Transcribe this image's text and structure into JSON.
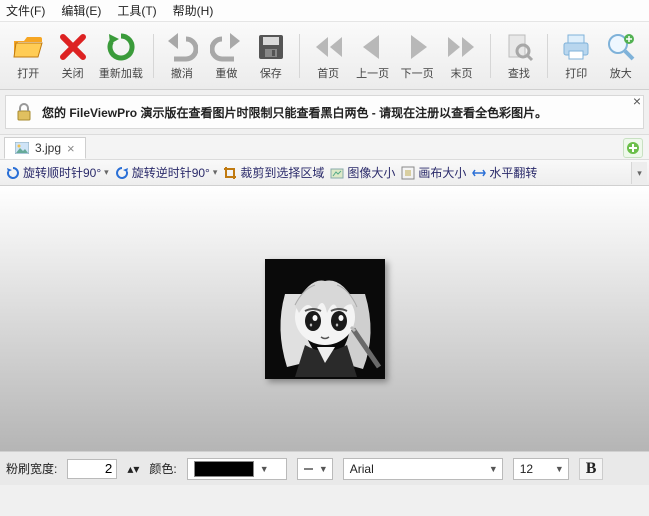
{
  "menu": {
    "file": "文件(F)",
    "edit": "编辑(E)",
    "tools": "工具(T)",
    "help": "帮助(H)"
  },
  "toolbar": {
    "open": "打开",
    "close": "关闭",
    "reload": "重新加载",
    "undo": "撤消",
    "redo": "重做",
    "save": "保存",
    "first": "首页",
    "prev": "上一页",
    "next": "下一页",
    "last": "末页",
    "find": "查找",
    "print": "打印",
    "zoom": "放大"
  },
  "banner": {
    "text": "您的 FileViewPro 演示版在查看图片时限制只能查看黑白两色 - 请现在注册以查看全色彩图片。"
  },
  "tab": {
    "label": "3.jpg"
  },
  "ops": {
    "rotate_cw": "旋转顺时针90°",
    "rotate_ccw": "旋转逆时针90°",
    "crop": "裁剪到选择区域",
    "image_size": "图像大小",
    "canvas_size": "画布大小",
    "flip_h": "水平翻转"
  },
  "footer": {
    "brush_label": "粉刷宽度:",
    "brush_value": "2",
    "color_label": "颜色:",
    "font_name": "Arial",
    "font_size": "12",
    "bold": "B"
  }
}
